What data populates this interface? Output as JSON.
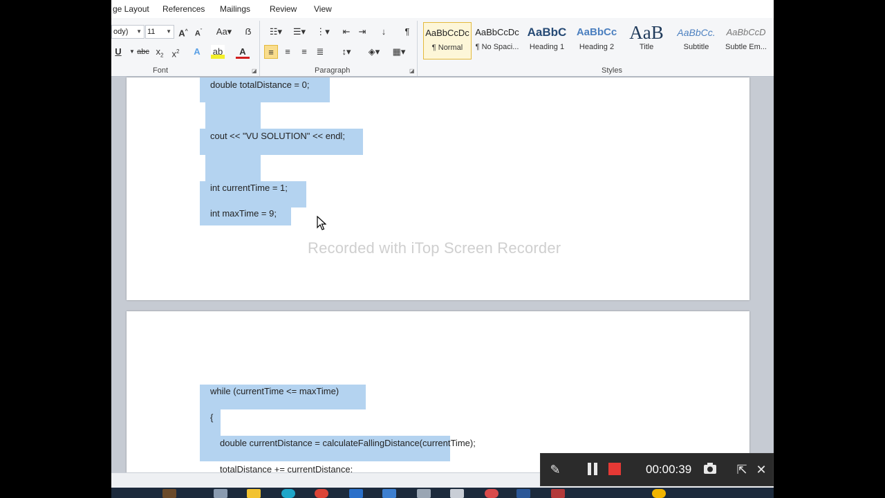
{
  "ribbon": {
    "tabs": [
      "ge Layout",
      "References",
      "Mailings",
      "Review",
      "View"
    ],
    "font_name": "ody)",
    "font_size": "11",
    "groups": {
      "font": "Font",
      "paragraph": "Paragraph",
      "styles": "Styles"
    },
    "styles": [
      {
        "preview": "AaBbCcDc",
        "name": "¶ Normal"
      },
      {
        "preview": "AaBbCcDc",
        "name": "¶ No Spaci..."
      },
      {
        "preview": "AaBbC",
        "name": "Heading 1"
      },
      {
        "preview": "AaBbCc",
        "name": "Heading 2"
      },
      {
        "preview": "AaB",
        "name": "Title"
      },
      {
        "preview": "AaBbCc.",
        "name": "Subtitle"
      },
      {
        "preview": "AaBbCcD",
        "name": "Subtle Em..."
      }
    ]
  },
  "document": {
    "page1_lines": [
      "double totalDistance = 0;",
      "cout << \"VU SOLUTION\" << endl;",
      "int currentTime = 1;",
      "int maxTime = 9;"
    ],
    "page2_lines": [
      "while (currentTime <= maxTime)",
      "{",
      "double currentDistance = calculateFallingDistance(currentTime);",
      "totalDistance += currentDistance;"
    ]
  },
  "watermark": "Recorded with iTop Screen Recorder",
  "recorder": {
    "time": "00:00:39",
    "icons": [
      "pen-icon",
      "pause-icon",
      "stop-icon",
      "camera-icon",
      "expand-icon",
      "close-icon"
    ]
  },
  "colors": {
    "selection": "#b4d3f0",
    "stop": "#e53935",
    "selected_style_border": "#e3b93c"
  }
}
